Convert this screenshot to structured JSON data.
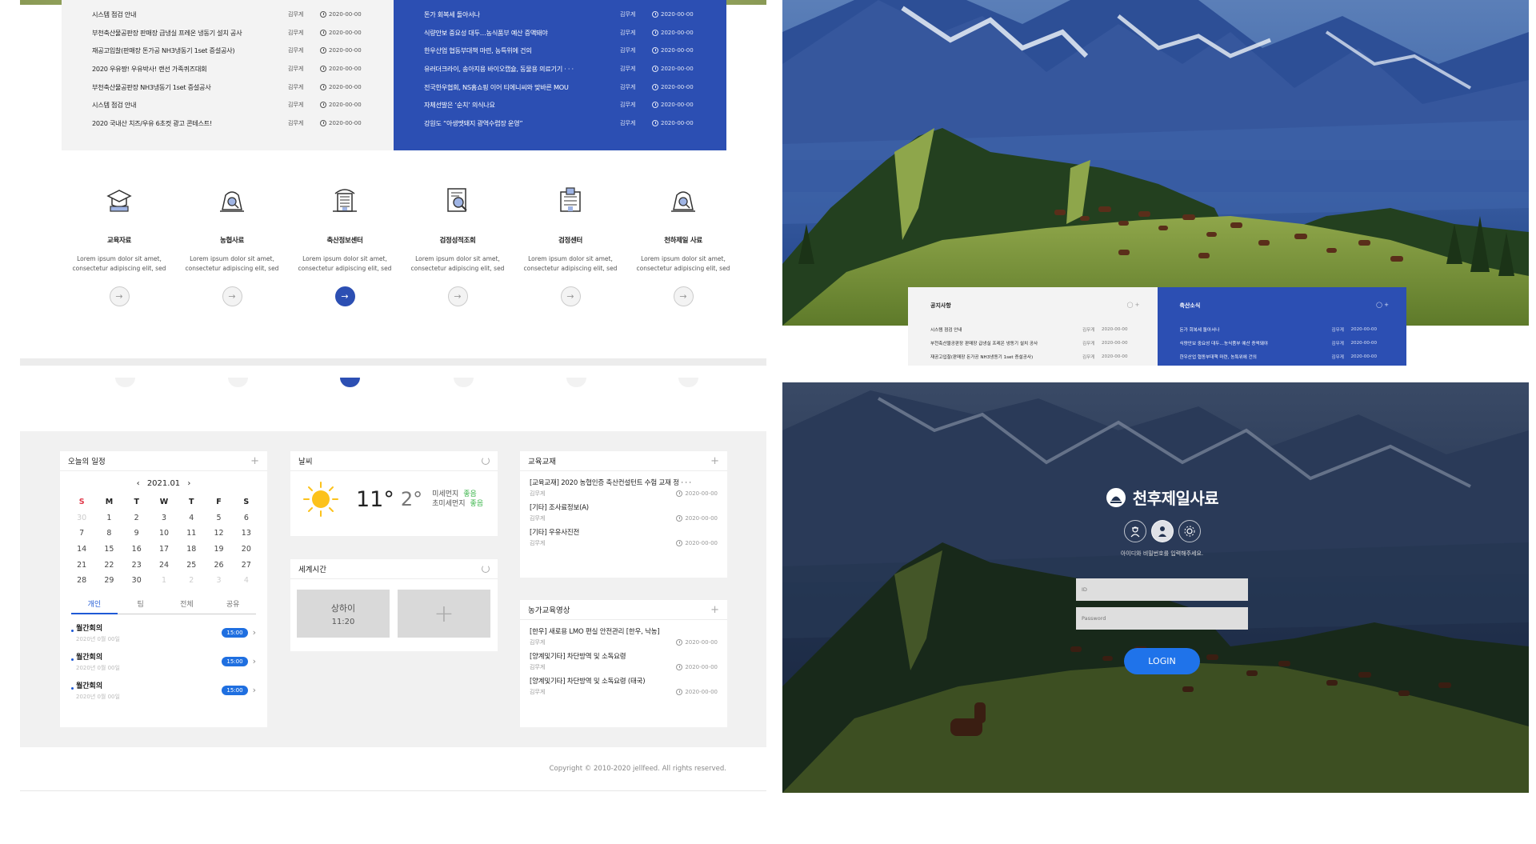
{
  "notices": [
    {
      "title": "시스템 점검 안내",
      "author": "김무게",
      "date": "2020-00-00"
    },
    {
      "title": "부천축산물공판장 판매장 급냉실 프레온 냉동기 설치 공사",
      "author": "김무게",
      "date": "2020-00-00"
    },
    {
      "title": "재공고입찰(판매장 돈가공 NH3냉동기 1set 증설공사)",
      "author": "김무게",
      "date": "2020-00-00"
    },
    {
      "title": "2020 우유짱! 우유박사! 랜선 가족퀴즈대회",
      "author": "김무게",
      "date": "2020-00-00"
    },
    {
      "title": "부천축산물공판장 NH3냉동기 1set 증설공사",
      "author": "김무게",
      "date": "2020-00-00"
    },
    {
      "title": "시스템 점검 안내",
      "author": "김무게",
      "date": "2020-00-00"
    },
    {
      "title": "2020 국내산 치즈/우유 6초컷 광고 콘테스트!",
      "author": "김무게",
      "date": "2020-00-00"
    }
  ],
  "livestock_news": [
    {
      "title": "돈가 회복세 돌아서나",
      "author": "김무게",
      "date": "2020-00-00"
    },
    {
      "title": "식량안보 중요성 대두…농식품부 예산 증액돼야",
      "author": "김무게",
      "date": "2020-00-00"
    },
    {
      "title": "한우산업 협동부대책 마련, 농특위에 건의",
      "author": "김무게",
      "date": "2020-00-00"
    },
    {
      "title": "유러더크라이, 송아지용 바이오캡슐, 동물용 의료기기 · · ·",
      "author": "김무게",
      "date": "2020-00-00"
    },
    {
      "title": "전국한우협회, NS홈쇼핑 이어 티에니씨와 맞바른 MOU",
      "author": "김무게",
      "date": "2020-00-00"
    },
    {
      "title": "자체선발은 ‘순치’ 의식나요",
      "author": "김무게",
      "date": "2020-00-00"
    },
    {
      "title": "강원도 “아생멧돼지 광역수렵장 운영”",
      "author": "김무게",
      "date": "2020-00-00"
    }
  ],
  "services": [
    {
      "name": "교육자료",
      "desc1": "Lorem ipsum dolor sit amet,",
      "desc2": "consectetur adipiscing elit, sed",
      "icon": "graduation-cap-icon"
    },
    {
      "name": "농협사료",
      "desc1": "Lorem ipsum dolor sit amet,",
      "desc2": "consectetur adipiscing elit, sed",
      "icon": "feed-search-icon"
    },
    {
      "name": "축산정보센터",
      "desc1": "Lorem ipsum dolor sit amet,",
      "desc2": "consectetur adipiscing elit, sed",
      "icon": "building-icon"
    },
    {
      "name": "검정성적조회",
      "desc1": "Lorem ipsum dolor sit amet,",
      "desc2": "consectetur adipiscing elit, sed",
      "icon": "document-search-icon"
    },
    {
      "name": "검정센터",
      "desc1": "Lorem ipsum dolor sit amet,",
      "desc2": "consectetur adipiscing elit, sed",
      "icon": "hospital-icon"
    },
    {
      "name": "천하제일 사료",
      "desc1": "Lorem ipsum dolor sit amet,",
      "desc2": "consectetur adipiscing elit, sed",
      "icon": "feed-search-icon"
    }
  ],
  "active_service": 2,
  "calendar": {
    "title": "오늘의 일정",
    "month": "2021.01",
    "weekdays": [
      "S",
      "M",
      "T",
      "W",
      "T",
      "F",
      "S"
    ],
    "weeks": [
      [
        "30",
        "1",
        "2",
        "3",
        "4",
        "5",
        "6"
      ],
      [
        "7",
        "8",
        "9",
        "10",
        "11",
        "12",
        "13"
      ],
      [
        "14",
        "15",
        "16",
        "17",
        "18",
        "19",
        "20"
      ],
      [
        "21",
        "22",
        "23",
        "24",
        "25",
        "26",
        "27"
      ],
      [
        "28",
        "29",
        "30",
        "1",
        "2",
        "3",
        "4"
      ]
    ],
    "tabs": [
      "개인",
      "팀",
      "전체",
      "공유"
    ],
    "events": [
      {
        "title": "월간회의",
        "sub": "2020년 0월 00일",
        "time": "15:00"
      },
      {
        "title": "월간회의",
        "sub": "2020년 0월 00일",
        "time": "15:00"
      },
      {
        "title": "월간회의",
        "sub": "2020년 0월 00일",
        "time": "15:00"
      }
    ]
  },
  "weather": {
    "title": "날씨",
    "temp_now": "11°",
    "temp_low": "2°",
    "dust_label": "미세먼지",
    "dust_value": "좋음",
    "ultra_label": "초미세먼지",
    "ultra_value": "좋음"
  },
  "world_time": {
    "title": "세계시간",
    "city": "상하이",
    "time": "11:20"
  },
  "education": {
    "title": "교육교재",
    "items": [
      {
        "title": "[교육교재] 2020 농협인증 축산컨설턴트 수험 교재 정 · · ·",
        "author": "김무게",
        "date": "2020-00-00"
      },
      {
        "title": "[기타] 조사료정보(A)",
        "author": "김무게",
        "date": "2020-00-00"
      },
      {
        "title": "[기타] 우유사진전",
        "author": "김무게",
        "date": "2020-00-00"
      }
    ]
  },
  "farm_video": {
    "title": "농가교육영상",
    "items": [
      {
        "title": "[한우] 새로용 LMO 편실 안전관리 [한우, 낙농]",
        "author": "김무게",
        "date": "2020-00-00"
      },
      {
        "title": "[양계및기타] 차단방역 및 소독요령",
        "author": "김무게",
        "date": "2020-00-00"
      },
      {
        "title": "[양계및기타] 차단방역 및 소독요령 (태국)",
        "author": "김무게",
        "date": "2020-00-00"
      }
    ]
  },
  "copyright": "Copyright © 2010-2020 jellfeed. All rights reserved.",
  "preview_news": {
    "left_title": "공지사항",
    "right_title": "축산소식",
    "controls": "◯ +",
    "left": [
      {
        "title": "시스템 점검 안내",
        "author": "김무게",
        "date": "2020-00-00"
      },
      {
        "title": "부천축산물공판장 판매장 급냉실 프레온 냉동기 설치 공사",
        "author": "김무게",
        "date": "2020-00-00"
      },
      {
        "title": "재공고입찰(판매장 돈가공 NH3냉동기 1set 증설공사)",
        "author": "김무게",
        "date": "2020-00-00"
      }
    ],
    "right": [
      {
        "title": "돈가 회복세 돌아서나",
        "author": "김무게",
        "date": "2020-00-00"
      },
      {
        "title": "식량안보 중요성 대두…농식품부 예산 증액돼야",
        "author": "김무게",
        "date": "2020-00-00"
      },
      {
        "title": "한우산업 협동부대책 마련, 농특위에 건의",
        "author": "김무게",
        "date": "2020-00-00"
      }
    ]
  },
  "login": {
    "brand": "천후제일사료",
    "hint": "아이디와 비밀번호를 입력해주세요.",
    "id_placeholder": "ID",
    "pw_placeholder": "Password",
    "button": "LOGIN"
  },
  "colors": {
    "accent_blue": "#2c4fb3",
    "button_blue": "#1f73ea",
    "good_green": "#3bb54a",
    "sunday_red": "#e0394a"
  }
}
